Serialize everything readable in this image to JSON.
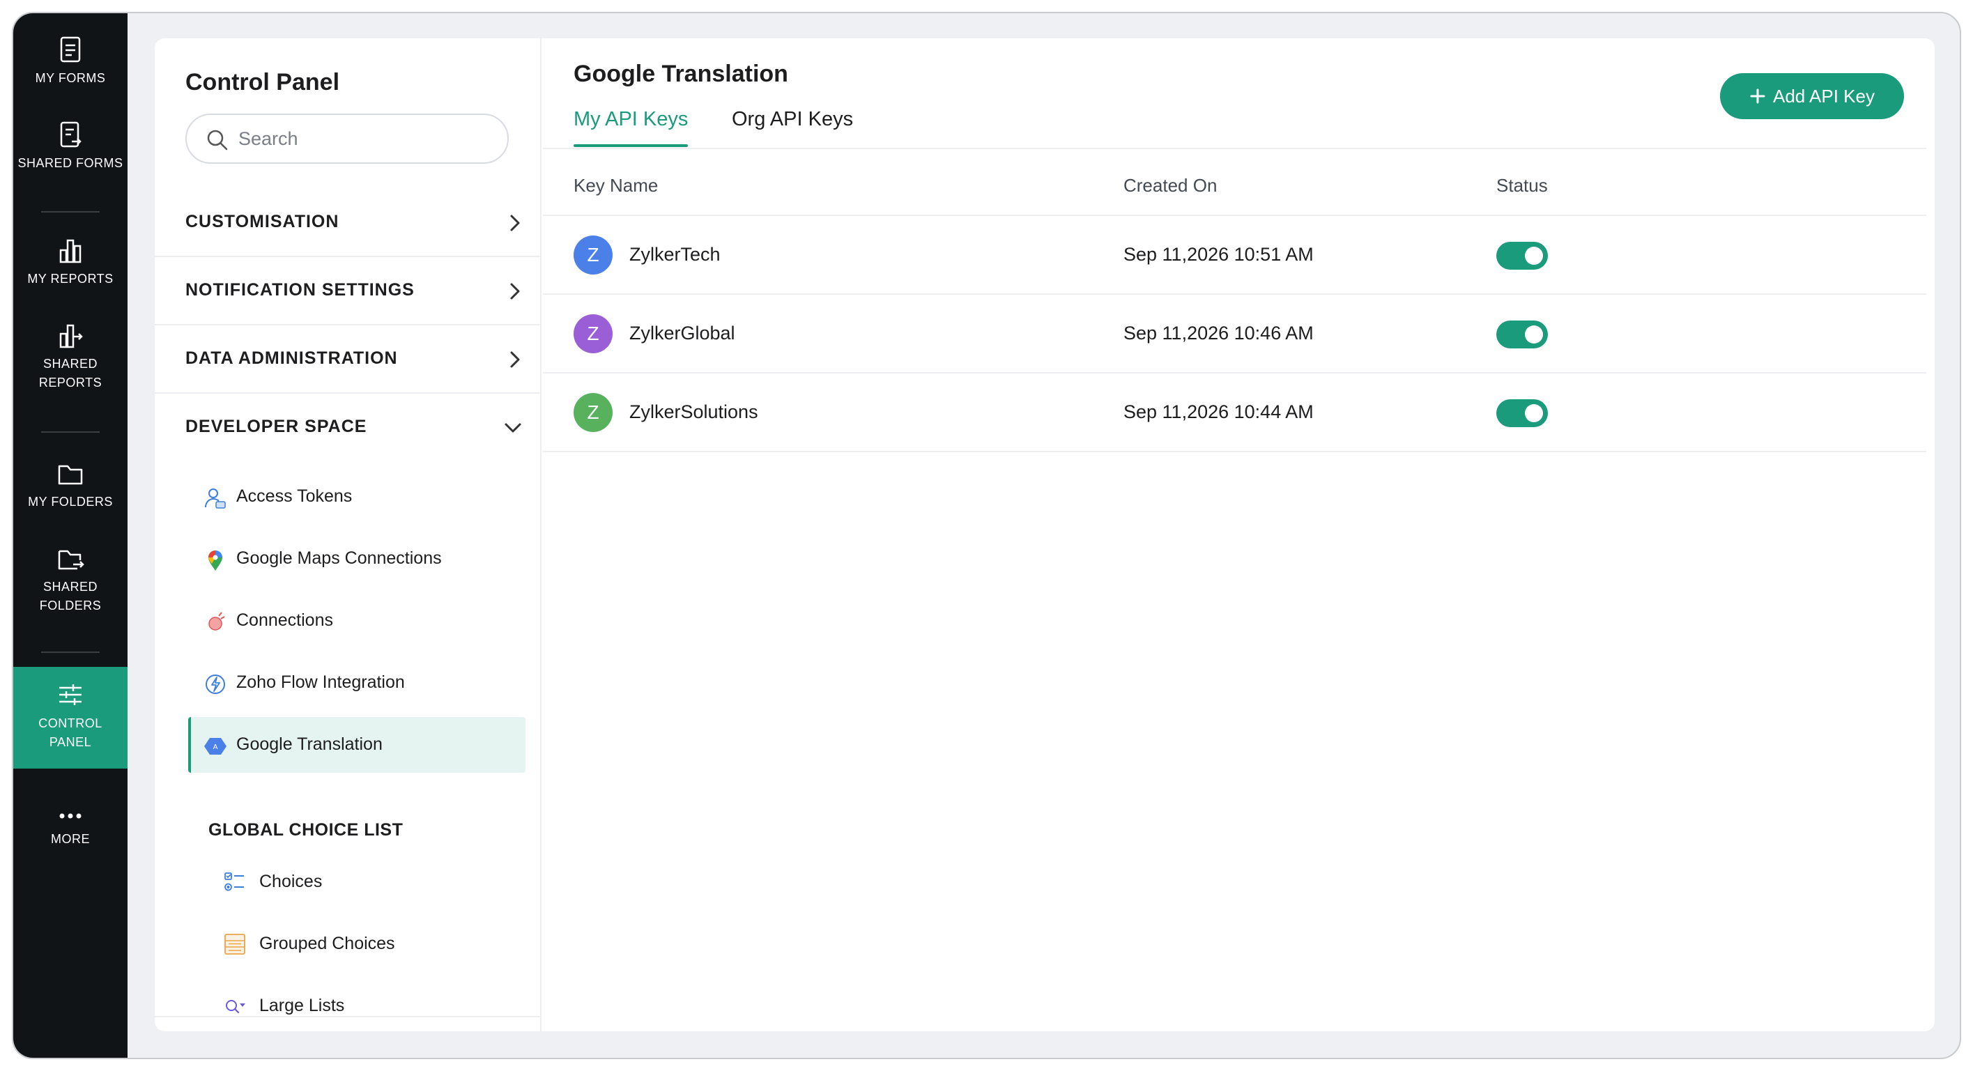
{
  "nav": {
    "items": [
      {
        "label": "MY FORMS",
        "icon": "form-icon"
      },
      {
        "label": "SHARED FORMS",
        "icon": "shared-form-icon"
      },
      {
        "label": "MY REPORTS",
        "icon": "bar-chart-icon"
      },
      {
        "label": "SHARED\nREPORTS",
        "icon": "shared-report-icon"
      },
      {
        "label": "MY FOLDERS",
        "icon": "folder-icon"
      },
      {
        "label": "SHARED\nFOLDERS",
        "icon": "shared-folder-icon"
      },
      {
        "label": "CONTROL\nPANEL",
        "icon": "sliders-icon"
      },
      {
        "label": "MORE",
        "icon": "more-icon"
      }
    ],
    "active": "CONTROL PANEL",
    "active_color": "#1a9b7c"
  },
  "sidebar": {
    "title": "Control Panel",
    "search_placeholder": "Search",
    "sections": [
      {
        "label": "CUSTOMISATION",
        "expanded": false
      },
      {
        "label": "NOTIFICATION SETTINGS",
        "expanded": false
      },
      {
        "label": "DATA ADMINISTRATION",
        "expanded": false
      },
      {
        "label": "DEVELOPER SPACE",
        "expanded": true
      }
    ],
    "developer_items": [
      {
        "label": "Access Tokens",
        "icon": "access-token-icon"
      },
      {
        "label": "Google Maps Connections",
        "icon": "map-pin-icon"
      },
      {
        "label": "Connections",
        "icon": "connections-icon"
      },
      {
        "label": "Zoho Flow Integration",
        "icon": "flow-icon"
      },
      {
        "label": "Google Translation",
        "icon": "translate-icon",
        "active": true
      }
    ],
    "global_choice_label": "GLOBAL CHOICE LIST",
    "global_items": [
      {
        "label": "Choices",
        "icon": "choices-icon"
      },
      {
        "label": "Grouped Choices",
        "icon": "grouped-choices-icon"
      },
      {
        "label": "Large Lists",
        "icon": "large-list-icon"
      }
    ]
  },
  "main": {
    "title": "Google Translation",
    "add_button": "Add API Key",
    "tabs": [
      {
        "label": "My API Keys",
        "active": true
      },
      {
        "label": "Org API Keys",
        "active": false
      }
    ],
    "columns": [
      "Key Name",
      "Created On",
      "Status"
    ],
    "rows": [
      {
        "initial": "Z",
        "name": "ZylkerTech",
        "created": "Sep 11,2026 10:51 AM",
        "enabled": true,
        "avatar_color": "#4a80e8"
      },
      {
        "initial": "Z",
        "name": "ZylkerGlobal",
        "created": "Sep 11,2026 10:46 AM",
        "enabled": true,
        "avatar_color": "#9a5fd6"
      },
      {
        "initial": "Z",
        "name": "ZylkerSolutions",
        "created": "Sep 11,2026 10:44 AM",
        "enabled": true,
        "avatar_color": "#57b15d"
      }
    ]
  }
}
